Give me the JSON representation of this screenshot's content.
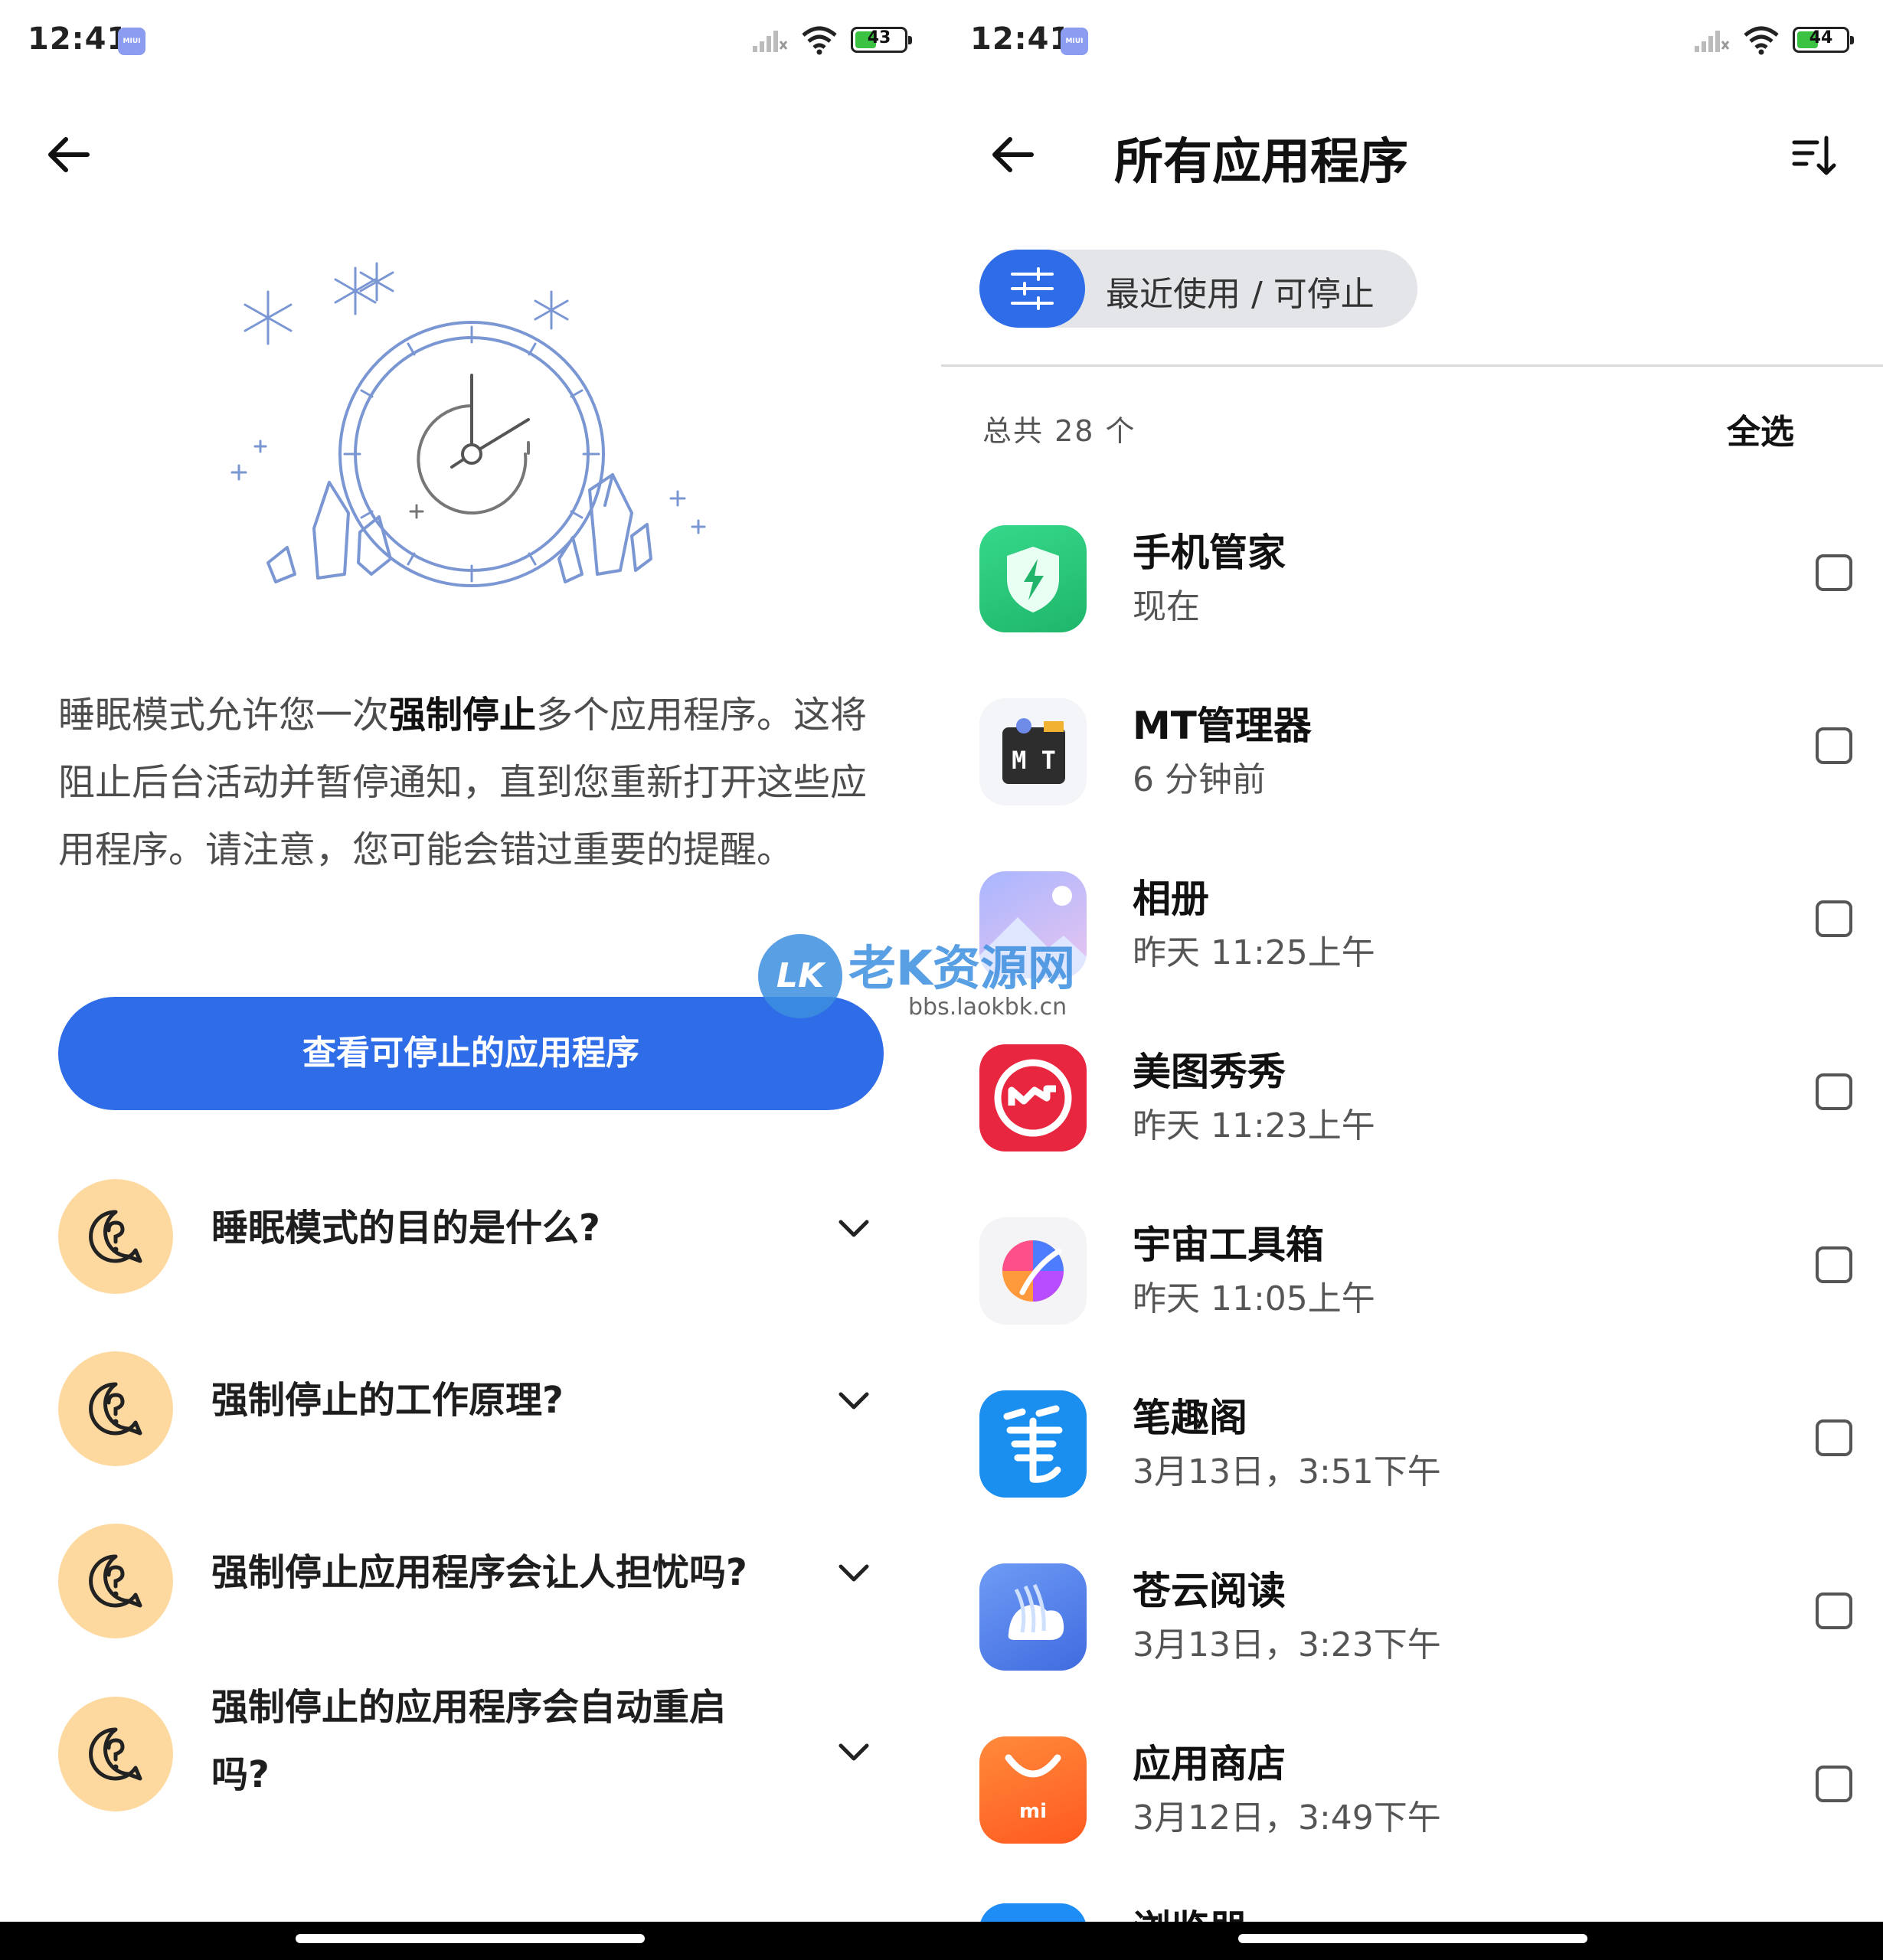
{
  "left": {
    "status": {
      "time": "12:41",
      "badge": "MIUI",
      "battery": "43",
      "battery_level": 0.43
    },
    "description": {
      "part1": "睡眠模式允许您一次",
      "emphasis": "强制停止",
      "part2": "多个应用程序。这将阻止后台活动并暂停通知，直到您重新打开这些应用程序。请注意，您可能会错过重要的提醒。"
    },
    "primary_button": "查看可停止的应用程序",
    "faqs": [
      {
        "q": "睡眠模式的目的是什么?"
      },
      {
        "q": "强制停止的工作原理?"
      },
      {
        "q": "强制停止应用程序会让人担忧吗?"
      },
      {
        "q": "强制停止的应用程序会自动重启吗?"
      }
    ],
    "colors": {
      "accent": "#2f6de8",
      "faq_icon_bg": "#fdd9a0",
      "illustration": "#7b97d3"
    }
  },
  "right": {
    "status": {
      "time": "12:41",
      "badge": "MIUI",
      "battery": "44",
      "battery_level": 0.44
    },
    "title": "所有应用程序",
    "filter_label": "最近使用 / 可停止",
    "total": "总共 28 个",
    "select_all": "全选",
    "apps": [
      {
        "name": "手机管家",
        "time": "现在",
        "icon": "shield-icon"
      },
      {
        "name": "MT管理器",
        "time": "6 分钟前",
        "icon": "mt-manager-icon"
      },
      {
        "name": "相册",
        "time": "昨天 11:25上午",
        "icon": "gallery-icon"
      },
      {
        "name": "美图秀秀",
        "time": "昨天 11:23上午",
        "icon": "meitu-icon"
      },
      {
        "name": "宇宙工具箱",
        "time": "昨天 11:05上午",
        "icon": "toolbox-icon"
      },
      {
        "name": "笔趣阁",
        "time": "3月13日，3:51下午",
        "icon": "biquge-icon"
      },
      {
        "name": "苍云阅读",
        "time": "3月13日，3:23下午",
        "icon": "cangyun-icon"
      },
      {
        "name": "应用商店",
        "time": "3月12日，3:49下午",
        "icon": "app-store-icon"
      },
      {
        "name": "浏览器",
        "time": "",
        "icon": "browser-icon"
      }
    ]
  },
  "watermark": {
    "logo": "LK",
    "title": "老K资源网",
    "url": "bbs.laokbk.cn"
  }
}
